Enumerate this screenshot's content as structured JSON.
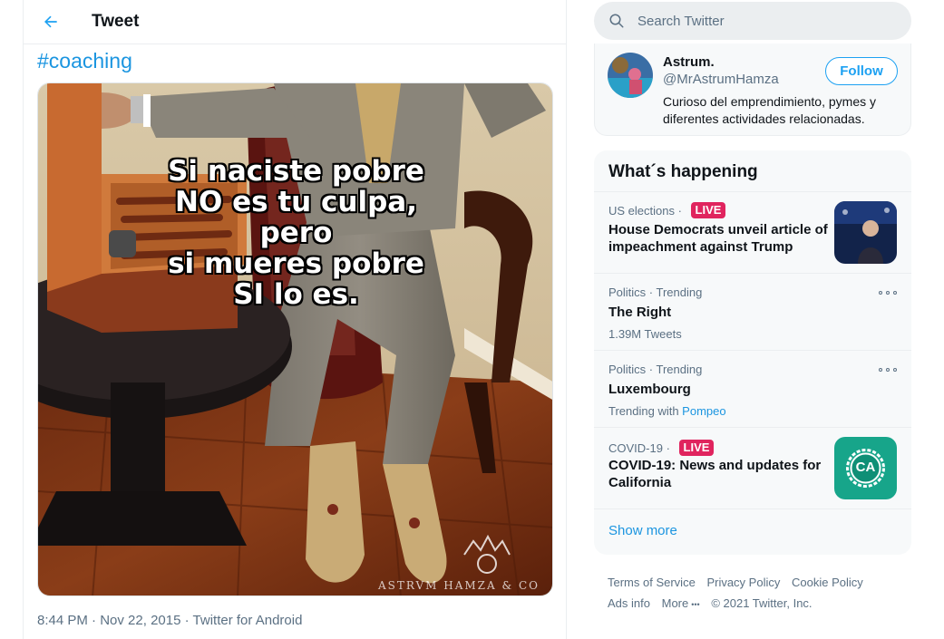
{
  "header": {
    "title": "Tweet",
    "back_icon": "arrow-left-icon"
  },
  "tweet": {
    "hashtag": "#coaching",
    "meme_lines": [
      "Si naciste pobre",
      "NO es tu culpa,",
      "pero",
      "si mueres pobre",
      "SI lo es."
    ],
    "watermark": "ASTRVM HAMZA & CO",
    "time": "8:44 PM",
    "date": "Nov 22, 2015",
    "source": "Twitter for Android"
  },
  "search": {
    "placeholder": "Search Twitter",
    "icon": "search-icon"
  },
  "profile": {
    "name": "Astrum.",
    "handle": "@MrAstrumHamza",
    "bio": "Curioso del emprendimiento, pymes y diferentes actividades relacionadas.",
    "follow_label": "Follow"
  },
  "trends": {
    "title": "What´s happening",
    "items": [
      {
        "category": "US elections",
        "separator": " · ",
        "live": "LIVE",
        "title": "House Democrats unveil article of impeachment against Trump"
      },
      {
        "category": "Politics · Trending",
        "title": "The Right",
        "sub": "1.39M Tweets"
      },
      {
        "category": "Politics · Trending",
        "title": "Luxembourg",
        "sub_prefix": "Trending with ",
        "sub_link": "Pompeo"
      },
      {
        "category": "COVID-19",
        "separator": " · ",
        "live": "LIVE",
        "title": "COVID-19: News and updates for California",
        "thumb_text": "CA"
      }
    ],
    "show_more": "Show more"
  },
  "footer": {
    "links": [
      "Terms of Service",
      "Privacy Policy",
      "Cookie Policy",
      "Ads info",
      "More"
    ],
    "more_dots": "•••",
    "copyright": "© 2021 Twitter, Inc."
  },
  "colors": {
    "accent": "#1da1f2",
    "link": "#1b95e0",
    "live": "#e0245e",
    "secondary_text": "#5b7083"
  }
}
